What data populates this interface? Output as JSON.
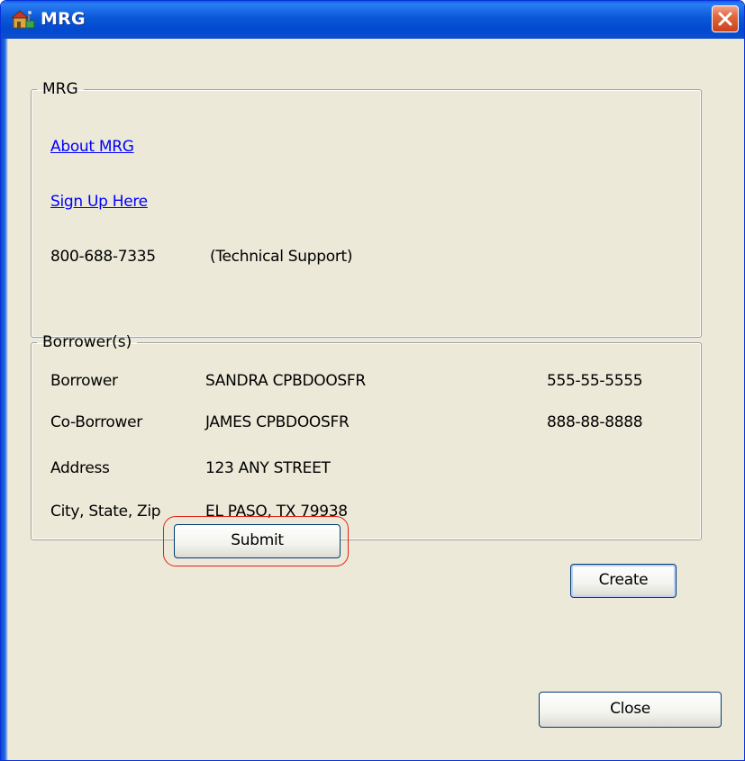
{
  "window": {
    "title": "MRG",
    "icon": "app-icon",
    "close_icon": "close-icon"
  },
  "mrg_group": {
    "legend": "MRG",
    "about_link": "About MRG",
    "signup_link": "Sign Up Here",
    "phone": "800-688-7335",
    "phone_note": "(Technical Support)"
  },
  "borrowers_group": {
    "legend": "Borrower(s)",
    "rows": [
      {
        "label": "Borrower",
        "value": "SANDRA CPBDOOSFR",
        "ssn": "555-55-5555"
      },
      {
        "label": "Co-Borrower",
        "value": "JAMES CPBDOOSFR",
        "ssn": "888-88-8888"
      },
      {
        "label": "Address",
        "value": "123 ANY STREET",
        "ssn": ""
      },
      {
        "label": "City, State, Zip",
        "value": "EL PASO, TX 79938",
        "ssn": ""
      }
    ]
  },
  "buttons": {
    "submit": "Submit",
    "create": "Create",
    "close": "Close"
  },
  "colors": {
    "title_bar": "#0a58d9",
    "dialog_bg": "#ece9d8",
    "link": "#0000ff",
    "highlight": "#e2231a"
  }
}
